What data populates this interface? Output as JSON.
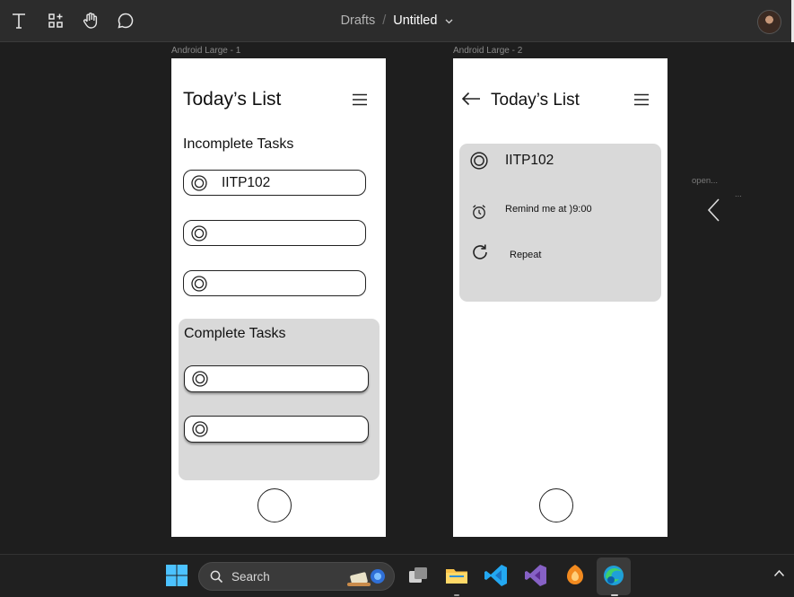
{
  "toolbar": {
    "breadcrumb_root": "Drafts",
    "separator": "/",
    "file_name": "Untitled"
  },
  "frames": [
    {
      "label": "Android Large - 1",
      "title": "Today’s List",
      "incomplete_heading": "Incomplete Tasks",
      "incomplete_tasks": [
        "IITP102",
        "",
        ""
      ],
      "complete_heading": "Complete Tasks",
      "complete_tasks": [
        "",
        ""
      ]
    },
    {
      "label": "Android Large - 2",
      "title": "Today’s List",
      "task_name": "IITP102",
      "remind_text": "Remind me at )9:00",
      "repeat_text": "Repeat"
    }
  ],
  "canvas_note": {
    "text": "open...",
    "dots": "..."
  },
  "taskbar": {
    "search_label": "Search"
  },
  "colors": {
    "app_bg": "#1e1e1e",
    "toolbar_bg": "#2c2c2c",
    "card_gray": "#d9d9d9",
    "taskbar_bg": "#202020",
    "vscode_blue": "#23a8f2",
    "vs_purple": "#8661c5",
    "folder_yellow": "#f8c34a"
  },
  "icons": {
    "toolbar": [
      "text-tool-icon",
      "components-icon",
      "hand-tool-icon",
      "comment-icon",
      "chevron-down-icon"
    ],
    "frame": [
      "menu-icon",
      "radio-ring-icon",
      "back-arrow-icon",
      "alarm-clock-icon",
      "repeat-icon"
    ],
    "taskbar": [
      "windows-start-icon",
      "search-icon",
      "task-view-icon",
      "file-explorer-icon",
      "vscode-icon",
      "visual-studio-icon",
      "fl-studio-icon",
      "edge-icon",
      "tray-chevron-up-icon"
    ]
  }
}
